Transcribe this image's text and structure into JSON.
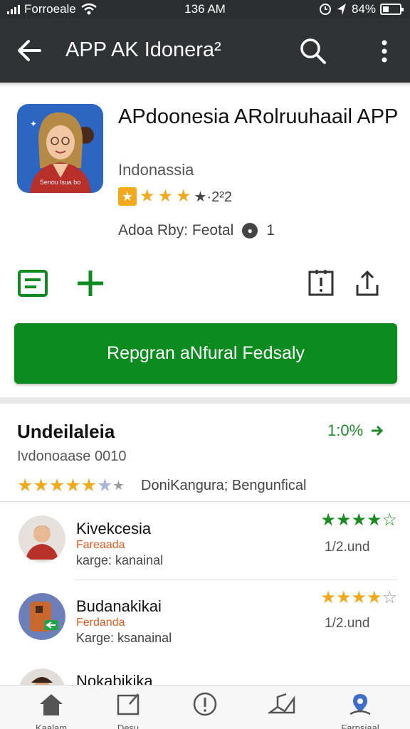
{
  "status_bar": {
    "carrier": "Forroeale",
    "time": "136 AM",
    "battery": "84%"
  },
  "app_bar": {
    "title": "APP AK Idonera²"
  },
  "app": {
    "name": "APdoonesia ARolruuhaail APP",
    "developer": "Indonassia",
    "rating_stars": 3,
    "rating_text": "★·2²2",
    "added_by": "Adoa Rby: Feotal",
    "download_count": "1",
    "icon_caption": "Senou lsua bo"
  },
  "install_button": {
    "label": "Repgran aNfural Fedsaly"
  },
  "reviews": {
    "title": "Undeilaleia",
    "link": "1:0%",
    "subtitle": "Ivdonoaase 0010",
    "summary_stars": 5,
    "summary_note": "DoniKangura; Bengunfical",
    "items": [
      {
        "name": "Kivekcesia",
        "tag": "Fareaada",
        "meta": "karge: kanainal",
        "stars": 4,
        "date": "1/2.und"
      },
      {
        "name": "Budanakikai",
        "tag": "Ferdanda",
        "meta": "Karge: ksanainal",
        "stars": 4,
        "date": "1/2.und"
      },
      {
        "name": "Nokabikika",
        "tag": "",
        "meta": "",
        "stars": 0,
        "date": ""
      }
    ]
  },
  "bottom_nav": [
    {
      "label": "Kaalam",
      "icon": "home-icon"
    },
    {
      "label": "Desu",
      "icon": "edit-icon"
    },
    {
      "label": "",
      "icon": "info-icon"
    },
    {
      "label": "",
      "icon": "map-icon"
    },
    {
      "label": "Farnsiaal",
      "icon": "location-icon"
    }
  ],
  "colors": {
    "accent_green": "#0c8c1e",
    "star": "#f2a91c",
    "bar": "#303234"
  }
}
